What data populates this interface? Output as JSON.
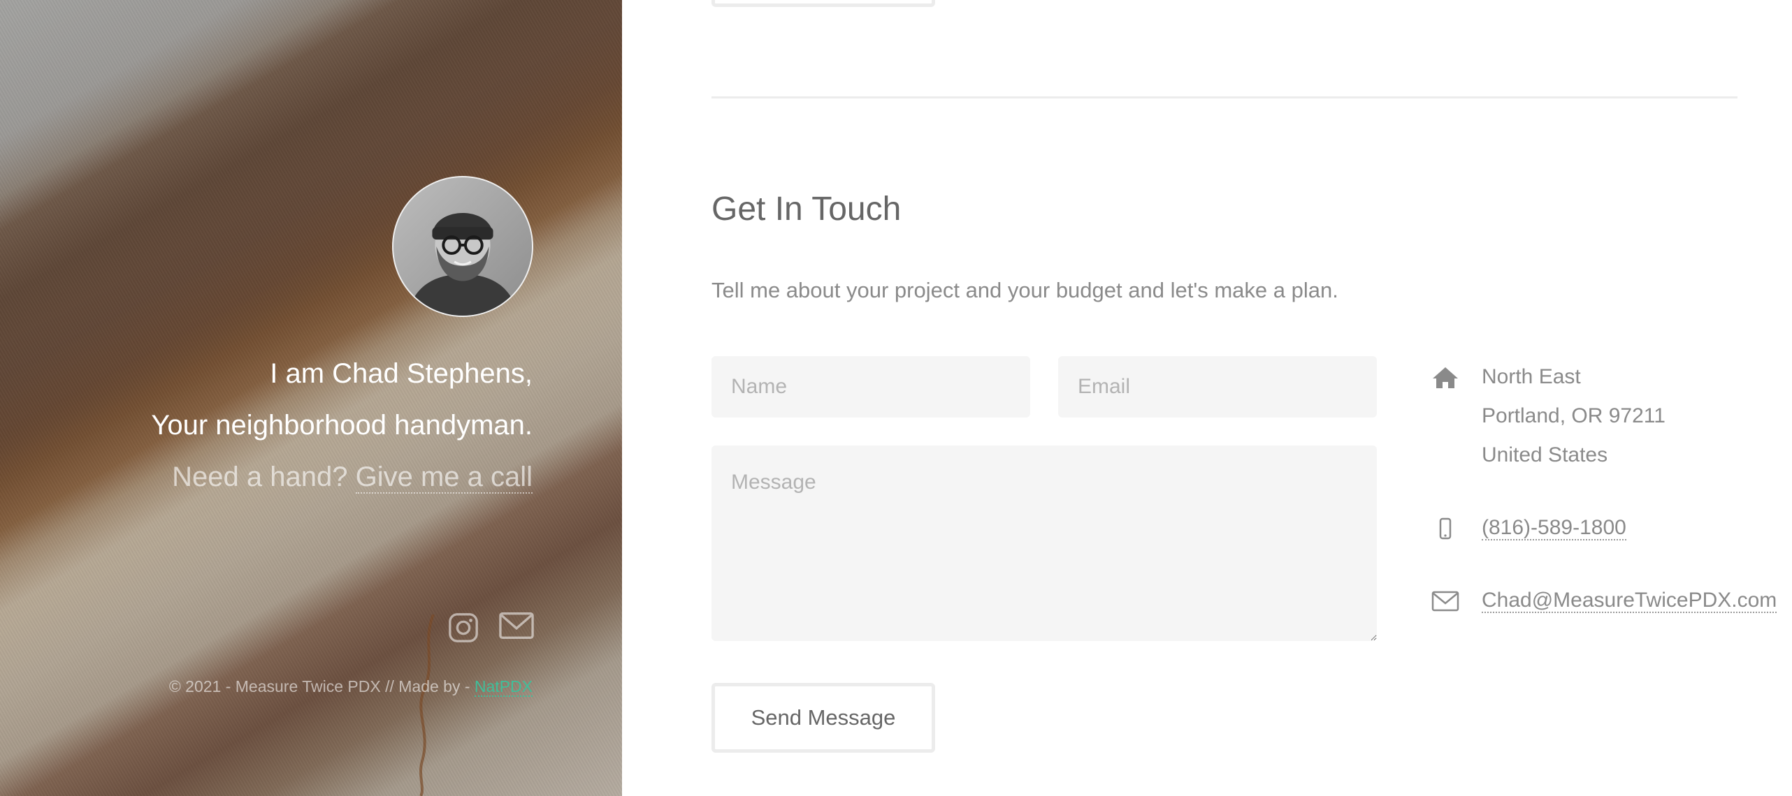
{
  "hero": {
    "intro_line1": "I am Chad Stephens,",
    "intro_line2": "Your neighborhood handyman.",
    "cta_text": "Need a hand?",
    "cta_link": "Give me a call",
    "social": [
      "instagram-icon",
      "envelope-icon"
    ],
    "footer_text": "© 2021 - Measure Twice PDX // Made by -",
    "footer_link": "NatPDX"
  },
  "contact": {
    "title": "Get In Touch",
    "intro": "Tell me about your project and your budget and let's make a plan.",
    "form": {
      "name_placeholder": "Name",
      "email_placeholder": "Email",
      "message_placeholder": "Message",
      "submit_label": "Send Message"
    },
    "info": {
      "address_line1": "North East",
      "address_line2": "Portland, OR 97211",
      "address_line3": "United States",
      "phone": "(816)-589-1800",
      "email": "Chad@MeasureTwicePDX.com"
    }
  },
  "colors": {
    "accent_link": "#3fbf9a",
    "text_muted": "#8a8a8a",
    "field_bg": "#f5f5f5"
  }
}
